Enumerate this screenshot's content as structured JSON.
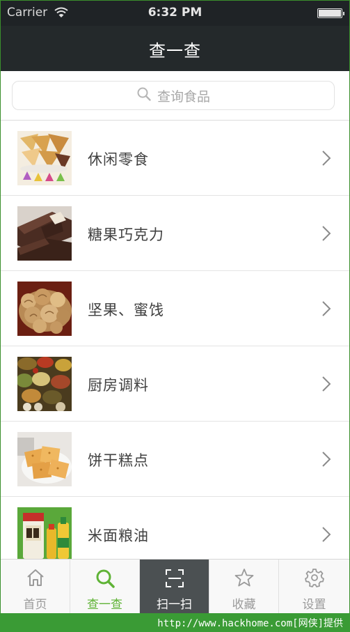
{
  "status_bar": {
    "carrier": "Carrier",
    "time": "6:32 PM"
  },
  "nav": {
    "title": "查一查"
  },
  "search": {
    "placeholder": "查询食品"
  },
  "categories": [
    {
      "label": "休闲零食",
      "thumb": "snack-image"
    },
    {
      "label": "糖果巧克力",
      "thumb": "chocolate-image"
    },
    {
      "label": "坚果、蜜饯",
      "thumb": "nuts-image"
    },
    {
      "label": "厨房调料",
      "thumb": "spices-image"
    },
    {
      "label": "饼干糕点",
      "thumb": "biscuit-image"
    },
    {
      "label": "米面粮油",
      "thumb": "rice-oil-image"
    }
  ],
  "tabs": [
    {
      "label": "首页",
      "icon": "home-icon"
    },
    {
      "label": "查一查",
      "icon": "search-icon",
      "active": true
    },
    {
      "label": "扫一扫",
      "icon": "scan-icon"
    },
    {
      "label": "收藏",
      "icon": "star-icon"
    },
    {
      "label": "设置",
      "icon": "gear-icon"
    }
  ],
  "watermark": "http://www.hackhome.com[网侠]提供",
  "colors": {
    "nav_bg": "#24292b",
    "accent_green": "#5fb336",
    "scan_tab_bg": "#4b5052",
    "watermark_bg": "#3a9b35"
  }
}
